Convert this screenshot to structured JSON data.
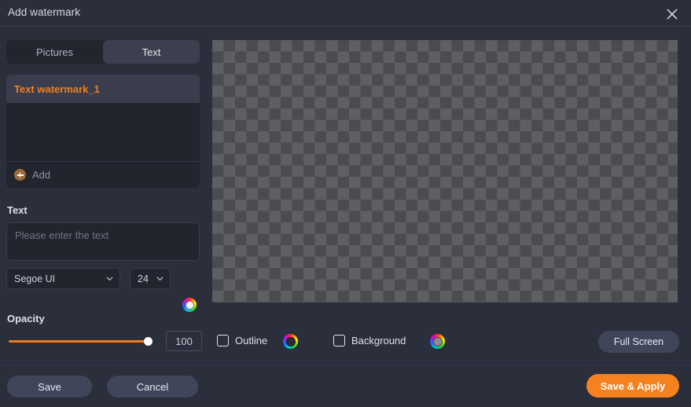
{
  "window": {
    "title": "Add watermark",
    "close_icon": "close-icon"
  },
  "tabs": [
    {
      "id": "pictures",
      "label": "Pictures",
      "active": false
    },
    {
      "id": "text",
      "label": "Text",
      "active": true
    }
  ],
  "watermark_list": {
    "items": [
      {
        "label": "Text watermark_1",
        "selected": true
      }
    ],
    "add": {
      "label": "Add",
      "icon": "plus-circle-icon"
    }
  },
  "text_section": {
    "label": "Text",
    "input": {
      "value": "",
      "placeholder": "Please enter the text"
    },
    "font": {
      "selected": "Segoe UI",
      "chevron_icon": "chevron-down-icon"
    },
    "size": {
      "selected": "24",
      "chevron_icon": "chevron-down-icon"
    },
    "color": {
      "icon": "color-wheel-icon",
      "swatch": "#f2f2f2"
    }
  },
  "opacity_section": {
    "label": "Opacity",
    "value": "100",
    "slider": {
      "percent": 100,
      "track_color": "#f07c1d",
      "knob_color": "#ffffff"
    }
  },
  "outline": {
    "label": "Outline",
    "checked": false,
    "color": {
      "icon": "color-wheel-icon",
      "swatch": "#2a2c38"
    }
  },
  "background": {
    "label": "Background",
    "checked": false,
    "color": {
      "icon": "color-wheel-icon",
      "swatch": "#8c8c8c"
    }
  },
  "fullscreen_button": {
    "label": "Full Screen"
  },
  "preview": {
    "type": "transparent-checkerboard",
    "checker_light": "#5d5f63",
    "checker_dark": "#4a4c50"
  },
  "footer": {
    "save_label": "Save",
    "cancel_label": "Cancel",
    "save_apply_label": "Save & Apply"
  },
  "theme": {
    "background": "#2b2e3b",
    "panel": "#22242e",
    "accent": "#f5821f",
    "text": "#dfe2ea"
  }
}
